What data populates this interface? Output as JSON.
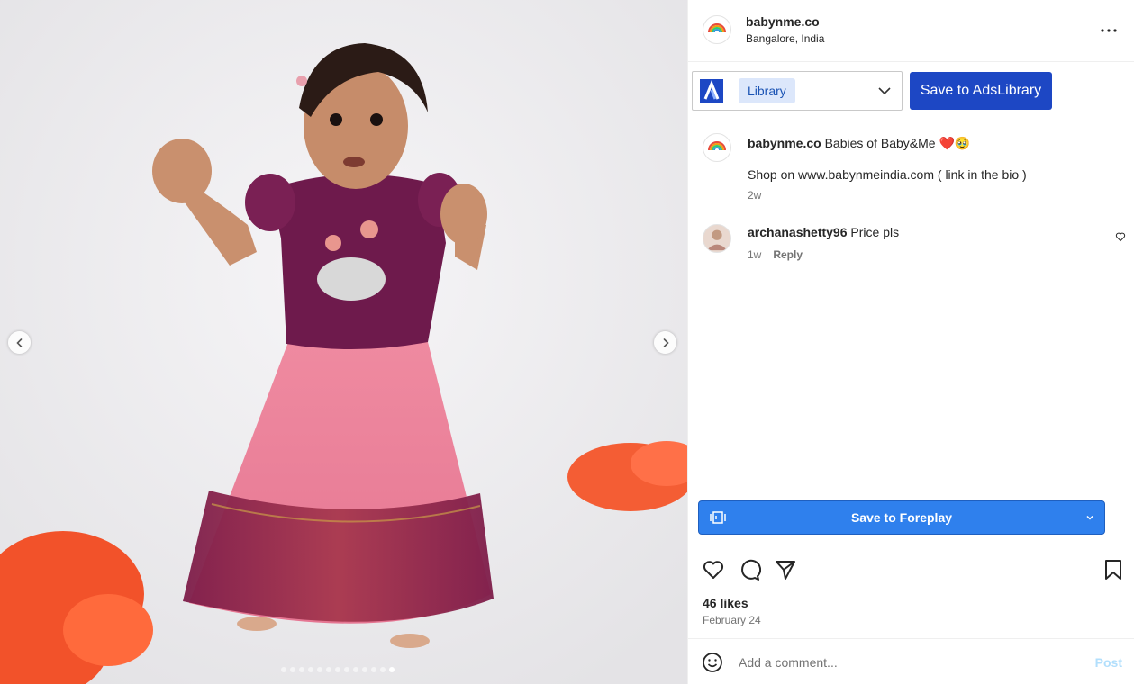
{
  "media": {
    "nav_prev_icon": "chevron-left-icon",
    "nav_next_icon": "chevron-right-icon",
    "carousel": {
      "count": 13,
      "active_index": 12
    }
  },
  "header": {
    "username": "babynme.co",
    "location": "Bangalore, India",
    "more_icon": "more-horizontal-icon"
  },
  "adslibrary": {
    "selected": "Library",
    "save_label": "Save to AdsLibrary",
    "logo_icon": "adslibrary-logo-icon"
  },
  "caption": {
    "username": "babynme.co",
    "text": "Babies of Baby&Me ❤️🥹",
    "line2": "Shop on www.babynmeindia.com ( link in the bio )",
    "time": "2w"
  },
  "comments": [
    {
      "username": "archanashetty96",
      "text": "Price pls",
      "time": "1w",
      "reply_label": "Reply"
    }
  ],
  "foreplay": {
    "label": "Save to Foreplay"
  },
  "actions": {
    "likes": "46 likes",
    "date": "February 24"
  },
  "add_comment": {
    "placeholder": "Add a comment...",
    "post_label": "Post"
  },
  "colors": {
    "ads_save_bg": "#1d47c4",
    "foreplay_bg": "#2f80ed",
    "post_disabled": "#b2dffc"
  }
}
